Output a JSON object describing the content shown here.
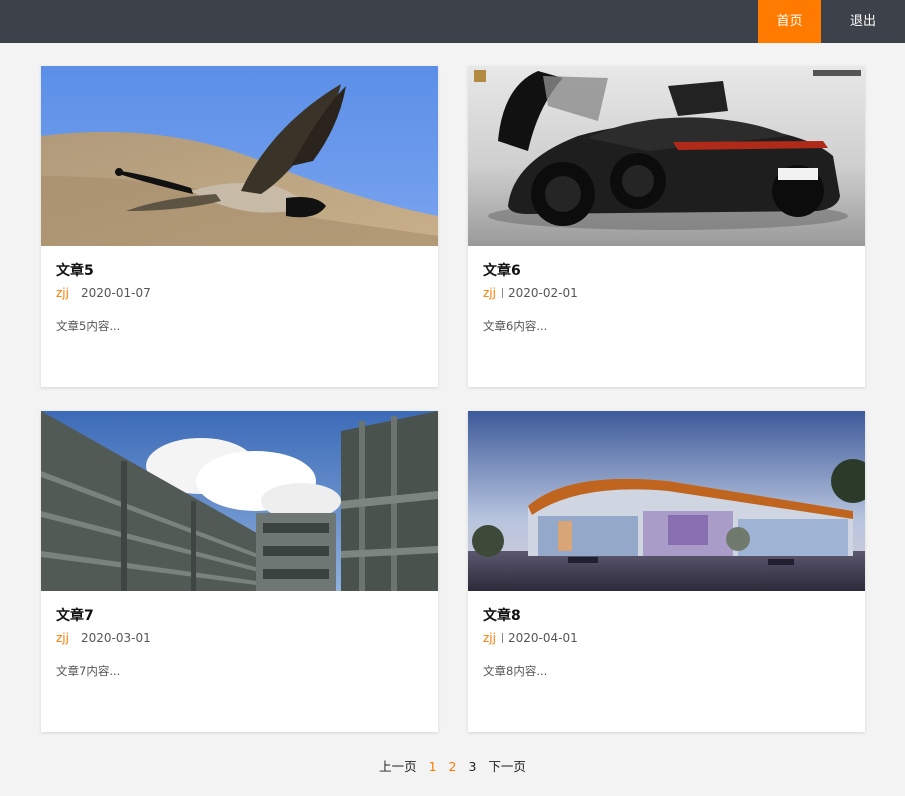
{
  "nav": {
    "home": "首页",
    "logout": "退出"
  },
  "cards": [
    {
      "title": "文章5",
      "author": "zjj",
      "date": "2020-01-07",
      "excerpt": "文章5内容...",
      "image": "goose-photo"
    },
    {
      "title": "文章6",
      "author": "zjj",
      "date": "2020-02-01",
      "excerpt": "文章6内容...",
      "image": "sports-car-photo"
    },
    {
      "title": "文章7",
      "author": "zjj",
      "date": "2020-03-01",
      "excerpt": "文章7内容...",
      "image": "building-photo"
    },
    {
      "title": "文章8",
      "author": "zjj",
      "date": "2020-04-01",
      "excerpt": "文章8内容...",
      "image": "mall-rendering-photo"
    }
  ],
  "pagination": {
    "prev": "上一页",
    "p1": "1",
    "p2": "2",
    "p3": "3",
    "next": "下一页"
  },
  "colors": {
    "accent": "#ff7b00",
    "topbar": "#3d414a",
    "background": "#f3f3f3"
  }
}
